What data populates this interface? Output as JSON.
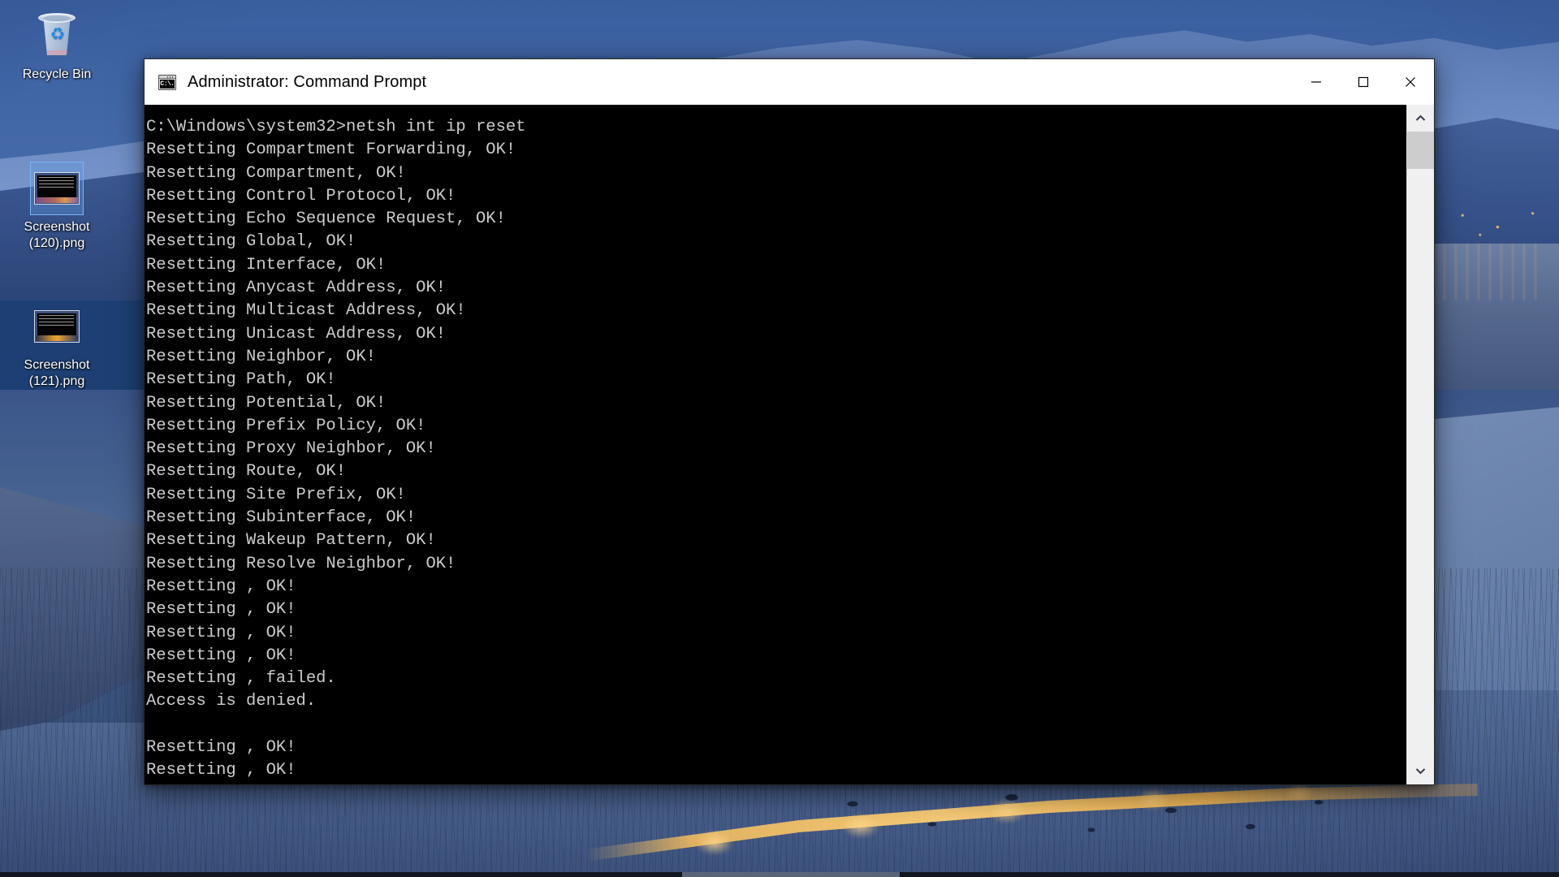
{
  "desktop": {
    "icons": [
      {
        "name": "Recycle Bin",
        "icon": "recycle-bin-icon",
        "label_line1": "Recycle Bin",
        "label_line2": "",
        "selected": false
      },
      {
        "name": "Screenshot (120).png",
        "icon": "png-image-icon",
        "label_line1": "Screenshot",
        "label_line2": "(120).png",
        "selected": true
      },
      {
        "name": "Screenshot (121).png",
        "icon": "png-image-icon",
        "label_line1": "Screenshot",
        "label_line2": "(121).png",
        "selected": false
      }
    ]
  },
  "window": {
    "title": "Administrator: Command Prompt",
    "icon": "command-prompt-icon",
    "icon_text": "C:\\.",
    "controls": {
      "minimize": "Minimize",
      "maximize": "Maximize",
      "close": "Close"
    },
    "colors": {
      "titlebar_bg": "#ffffff",
      "console_bg": "#000000",
      "console_fg": "#cccccc",
      "close_hover": "#e81123"
    }
  },
  "console": {
    "prompt": "C:\\Windows\\system32>",
    "command": "netsh int ip reset",
    "lines": [
      "C:\\Windows\\system32>netsh int ip reset",
      "Resetting Compartment Forwarding, OK!",
      "Resetting Compartment, OK!",
      "Resetting Control Protocol, OK!",
      "Resetting Echo Sequence Request, OK!",
      "Resetting Global, OK!",
      "Resetting Interface, OK!",
      "Resetting Anycast Address, OK!",
      "Resetting Multicast Address, OK!",
      "Resetting Unicast Address, OK!",
      "Resetting Neighbor, OK!",
      "Resetting Path, OK!",
      "Resetting Potential, OK!",
      "Resetting Prefix Policy, OK!",
      "Resetting Proxy Neighbor, OK!",
      "Resetting Route, OK!",
      "Resetting Site Prefix, OK!",
      "Resetting Subinterface, OK!",
      "Resetting Wakeup Pattern, OK!",
      "Resetting Resolve Neighbor, OK!",
      "Resetting , OK!",
      "Resetting , OK!",
      "Resetting , OK!",
      "Resetting , OK!",
      "Resetting , failed.",
      "Access is denied.",
      "",
      "Resetting , OK!",
      "Resetting , OK!"
    ]
  },
  "scrollbar": {
    "up_arrow": "scroll-up-icon",
    "down_arrow": "scroll-down-icon",
    "thumb_position_percent": 0,
    "thumb_size_percent": 6
  }
}
